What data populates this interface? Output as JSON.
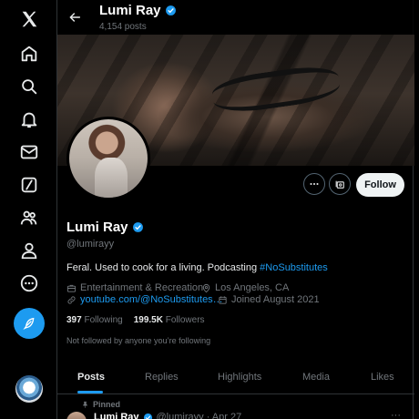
{
  "nav": {
    "items": [
      "x-logo-icon",
      "home-icon",
      "search-icon",
      "notifications-icon",
      "messages-icon",
      "grok-icon",
      "communities-icon",
      "profile-icon",
      "more-icon"
    ],
    "post_button_icon": "feather-icon"
  },
  "topbar": {
    "name": "Lumi Ray",
    "post_count": "4,154 posts"
  },
  "colors": {
    "accent": "#1d9bf0",
    "background": "#000000",
    "text_primary": "#e7e9ea",
    "text_secondary": "#71767b",
    "follow_bg": "#eff3f4"
  },
  "actions": {
    "follow_label": "Follow"
  },
  "profile": {
    "name": "Lumi Ray",
    "handle": "@lumirayy",
    "bio_text": "Feral. Used to cook for a living. Podcasting ",
    "bio_hashtag": "#NoSubstitutes",
    "category": "Entertainment & Recreation",
    "location": "Los Angeles, CA",
    "website": "youtube.com/@NoSubstitutes…",
    "joined": "Joined August 2021",
    "following_count": "397",
    "following_label": "Following",
    "followers_count": "199.5K",
    "followers_label": "Followers",
    "not_followed_note": "Not followed by anyone you’re following"
  },
  "tabs": [
    {
      "label": "Posts",
      "active": true
    },
    {
      "label": "Replies",
      "active": false
    },
    {
      "label": "Highlights",
      "active": false
    },
    {
      "label": "Media",
      "active": false
    },
    {
      "label": "Likes",
      "active": false
    }
  ],
  "pinned_post": {
    "pinned_label": "Pinned",
    "author_name": "Lumi Ray",
    "author_handle": "@lumirayy · Apr 27",
    "more": "···"
  }
}
